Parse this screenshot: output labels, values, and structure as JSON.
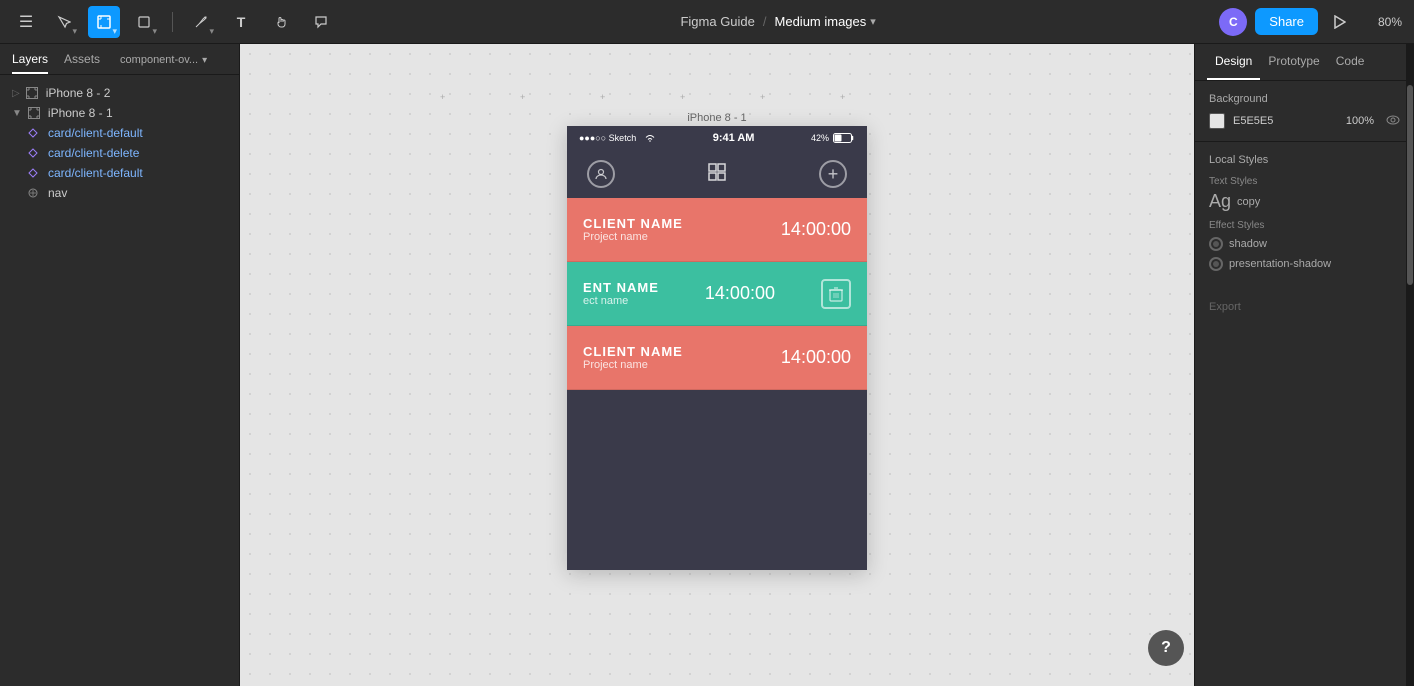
{
  "app": {
    "title": "Figma Guide",
    "subtitle": "Medium images",
    "zoom": "80%"
  },
  "toolbar": {
    "hamburger_label": "☰",
    "tools": [
      {
        "id": "pointer",
        "icon": "↖",
        "active": false
      },
      {
        "id": "select",
        "icon": "⊹",
        "active": true
      },
      {
        "id": "frame",
        "icon": "⬜",
        "active": false
      },
      {
        "id": "pen",
        "icon": "✒",
        "active": false
      },
      {
        "id": "text",
        "icon": "T",
        "active": false
      },
      {
        "id": "hand",
        "icon": "✋",
        "active": false
      },
      {
        "id": "comment",
        "icon": "💬",
        "active": false
      }
    ],
    "share_label": "Share",
    "zoom_label": "80%",
    "avatar_initials": "C"
  },
  "left_panel": {
    "tabs": [
      {
        "id": "layers",
        "label": "Layers",
        "active": true
      },
      {
        "id": "assets",
        "label": "Assets",
        "active": false
      }
    ],
    "component_filter": "component-ov...",
    "layers": [
      {
        "id": "iphone8-2",
        "label": "iPhone 8 - 2",
        "icon": "⊞",
        "indent": 0
      },
      {
        "id": "iphone8-1",
        "label": "iPhone 8 - 1",
        "icon": "⊞",
        "indent": 0
      },
      {
        "id": "card-default-1",
        "label": "card/client-default",
        "icon": "",
        "indent": 2,
        "color": "blue"
      },
      {
        "id": "card-delete",
        "label": "card/client-delete",
        "icon": "",
        "indent": 2,
        "color": "blue"
      },
      {
        "id": "card-default-2",
        "label": "card/client-default",
        "icon": "",
        "indent": 2,
        "color": "blue"
      },
      {
        "id": "nav",
        "label": "nav",
        "icon": "⊹",
        "indent": 1
      }
    ]
  },
  "canvas": {
    "frame_label": "iPhone 8 - 1",
    "background_color": "#e5e5e5"
  },
  "phone": {
    "status_bar": {
      "carrier": "●●●○○ Sketch",
      "wifi": "WiFi",
      "time": "9:41 AM",
      "battery_pct": "42%",
      "battery_icon": "🔋"
    },
    "nav": {
      "profile_icon": "👤",
      "grid_icon": "⊞",
      "add_icon": "+"
    },
    "cards": [
      {
        "id": "card1",
        "type": "default",
        "bg": "salmon",
        "client_name": "CLIENT NAME",
        "project_name": "Project name",
        "time": "14:00:00",
        "show_delete": false
      },
      {
        "id": "card2",
        "type": "delete",
        "bg": "teal",
        "client_name": "ENT NAME",
        "project_name": "ect name",
        "time": "14:00:00",
        "show_delete": true
      },
      {
        "id": "card3",
        "type": "default",
        "bg": "salmon",
        "client_name": "CLIENT NAME",
        "project_name": "Project name",
        "time": "14:00:00",
        "show_delete": false
      }
    ]
  },
  "right_panel": {
    "tabs": [
      {
        "id": "design",
        "label": "Design",
        "active": true
      },
      {
        "id": "prototype",
        "label": "Prototype",
        "active": false
      },
      {
        "id": "code",
        "label": "Code",
        "active": false
      }
    ],
    "background": {
      "title": "Background",
      "color_value": "E5E5E5",
      "opacity": "100%"
    },
    "local_styles": {
      "title": "Local Styles",
      "text_style": {
        "preview": "Ag",
        "label": "copy"
      },
      "effects_title": "Effect Styles",
      "effects": [
        {
          "id": "shadow",
          "label": "shadow"
        },
        {
          "id": "presentation-shadow",
          "label": "presentation-shadow"
        }
      ]
    },
    "export": {
      "title": "Export"
    }
  },
  "help": {
    "label": "?"
  }
}
